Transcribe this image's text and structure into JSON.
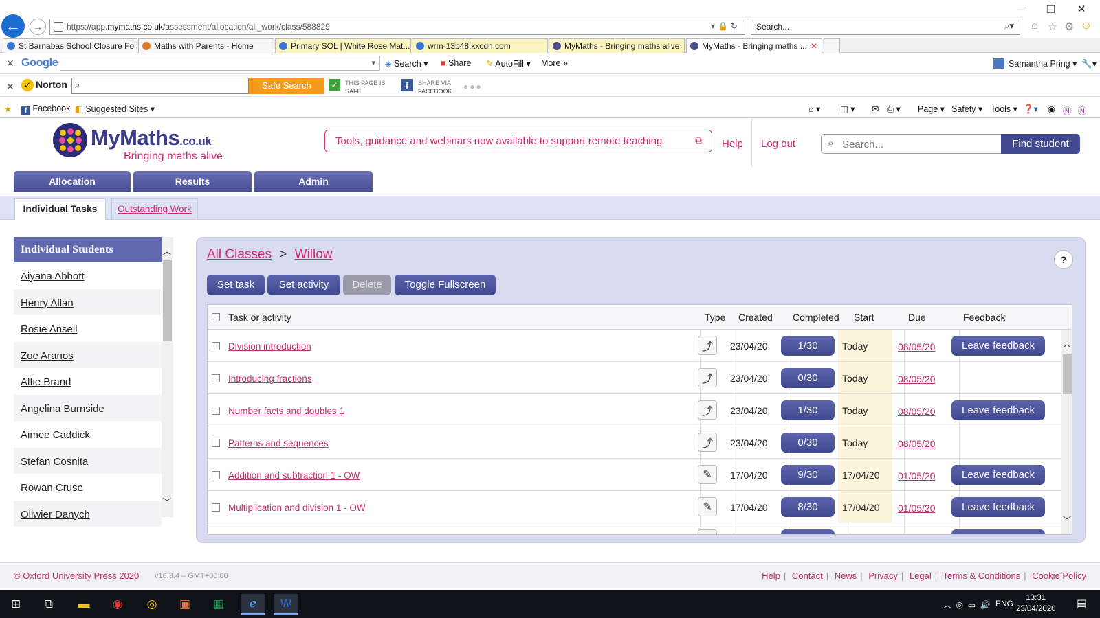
{
  "browser": {
    "url_prefix": "https://app.",
    "url_domain": "mymaths.co.uk",
    "url_path": "/assessment/allocation/all_work/class/588829",
    "search_placeholder": "Search...",
    "tabs": [
      {
        "label": "St Barnabas School Closure Fol..."
      },
      {
        "label": "Maths with Parents - Home"
      },
      {
        "label": "Primary SOL | White Rose Mat..."
      },
      {
        "label": "wrm-13b48.kxcdn.com"
      },
      {
        "label": "MyMaths - Bringing maths alive"
      },
      {
        "label": "MyMaths - Bringing maths ..."
      }
    ],
    "google": {
      "logo": "Google",
      "search": "Search",
      "share": "Share",
      "autofill": "AutoFill",
      "more": "More »",
      "user": "Samantha Pring"
    },
    "norton": {
      "logo": "Norton",
      "safe_search": "Safe Search",
      "page_safe_1": "THIS PAGE IS",
      "page_safe_2": "SAFE",
      "share_fb_1": "SHARE VIA",
      "share_fb_2": "FACEBOOK"
    },
    "favorites": {
      "facebook": "Facebook",
      "suggested": "Suggested Sites"
    },
    "commands": {
      "page": "Page",
      "safety": "Safety",
      "tools": "Tools"
    }
  },
  "header": {
    "logo_name": "MyMaths",
    "logo_tld": ".co.uk",
    "tagline": "Bringing maths alive",
    "banner": "Tools, guidance and webinars now available to support remote teaching",
    "help": "Help",
    "logout": "Log out",
    "search_placeholder": "Search...",
    "find_student": "Find student"
  },
  "main_tabs": [
    "Allocation",
    "Results",
    "Admin"
  ],
  "sub_tabs": {
    "individual": "Individual Tasks",
    "outstanding": "Outstanding Work"
  },
  "students": {
    "title": "Individual Students",
    "items": [
      "Aiyana Abbott",
      "Henry Allan",
      "Rosie Ansell",
      "Zoe Aranos",
      "Alfie Brand",
      "Angelina Burnside",
      "Aimee Caddick",
      "Stefan Cosnita",
      "Rowan Cruse",
      "Oliwier Danych"
    ]
  },
  "breadcrumb": {
    "all": "All Classes",
    "sep": ">",
    "current": "Willow"
  },
  "help_q": "?",
  "actions": {
    "set_task": "Set task",
    "set_activity": "Set activity",
    "delete": "Delete",
    "fullscreen": "Toggle Fullscreen"
  },
  "table": {
    "headers": {
      "task": "Task or activity",
      "type": "Type",
      "created": "Created",
      "completed": "Completed",
      "start": "Start",
      "due": "Due",
      "feedback": "Feedback"
    },
    "feedback_label": "Leave feedback",
    "rows": [
      {
        "task": "Division introduction",
        "type": "lesson",
        "created": "23/04/20",
        "completed": "1/30",
        "start": "Today",
        "due": "08/05/20",
        "feedback": true
      },
      {
        "task": "Introducing fractions",
        "type": "lesson",
        "created": "23/04/20",
        "completed": "0/30",
        "start": "Today",
        "due": "08/05/20",
        "feedback": false
      },
      {
        "task": "Number facts and doubles 1",
        "type": "lesson",
        "created": "23/04/20",
        "completed": "1/30",
        "start": "Today",
        "due": "08/05/20",
        "feedback": true
      },
      {
        "task": "Patterns and sequences",
        "type": "lesson",
        "created": "23/04/20",
        "completed": "0/30",
        "start": "Today",
        "due": "08/05/20",
        "feedback": false
      },
      {
        "task": "Addition and subtraction 1 - OW",
        "type": "worksheet",
        "created": "17/04/20",
        "completed": "9/30",
        "start": "17/04/20",
        "due": "01/05/20",
        "feedback": true
      },
      {
        "task": "Multiplication and division 1 - OW",
        "type": "worksheet",
        "created": "17/04/20",
        "completed": "8/30",
        "start": "17/04/20",
        "due": "01/05/20",
        "feedback": true
      }
    ]
  },
  "footer": {
    "copyright": "© Oxford University Press 2020",
    "version": "v16.3.4 – GMT+00:00",
    "links": [
      "Help",
      "Contact",
      "News",
      "Privacy",
      "Legal",
      "Terms & Conditions",
      "Cookie Policy"
    ]
  },
  "taskbar": {
    "lang": "ENG",
    "time": "13:31",
    "date": "23/04/2020"
  },
  "colors": {
    "brand_navy": "#414a8f",
    "brand_pink": "#d02a6e",
    "panel_bg": "#d8dbf0"
  }
}
